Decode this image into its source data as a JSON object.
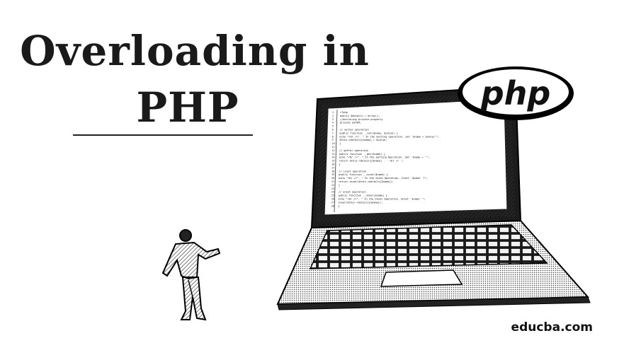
{
  "title": {
    "line1": "Overloading in",
    "line2": "PHP"
  },
  "badge": {
    "logo_text": "php"
  },
  "brand": {
    "site": "educba.com"
  },
  "code_lines": [
    "<?php",
    "public $details = array();",
    "//declaring private property",
    "private $ITEM;",
    "",
    "// setter operation",
    "public function __set($name, $value) {",
    "  echo \"<br />\". \" In the Setting operation. Set '$name = $value'\";",
    "  $this->details[$name] = $value;",
    "}",
    "",
    "// getter operation",
    "public function __get($name) {",
    "  echo \"<br />\". \" In the Getting Operation. Get '$name = '\";",
    "  return $this->details[$name] . ' <br /> ';",
    "}",
    "",
    "// isset operation",
    "public function __isset($name) {",
    "echo \"<br />\". \" In the Isset Operation. Isset '$name' ?\";",
    "  return isset($this->details[$name]);",
    "}",
    "",
    "// unset operation",
    "public function __unset($name) {",
    "  echo \"<br />\". \" In the Unset Operation. Unset '$name' \";",
    "  unset($this->details[$name]);",
    "}"
  ]
}
